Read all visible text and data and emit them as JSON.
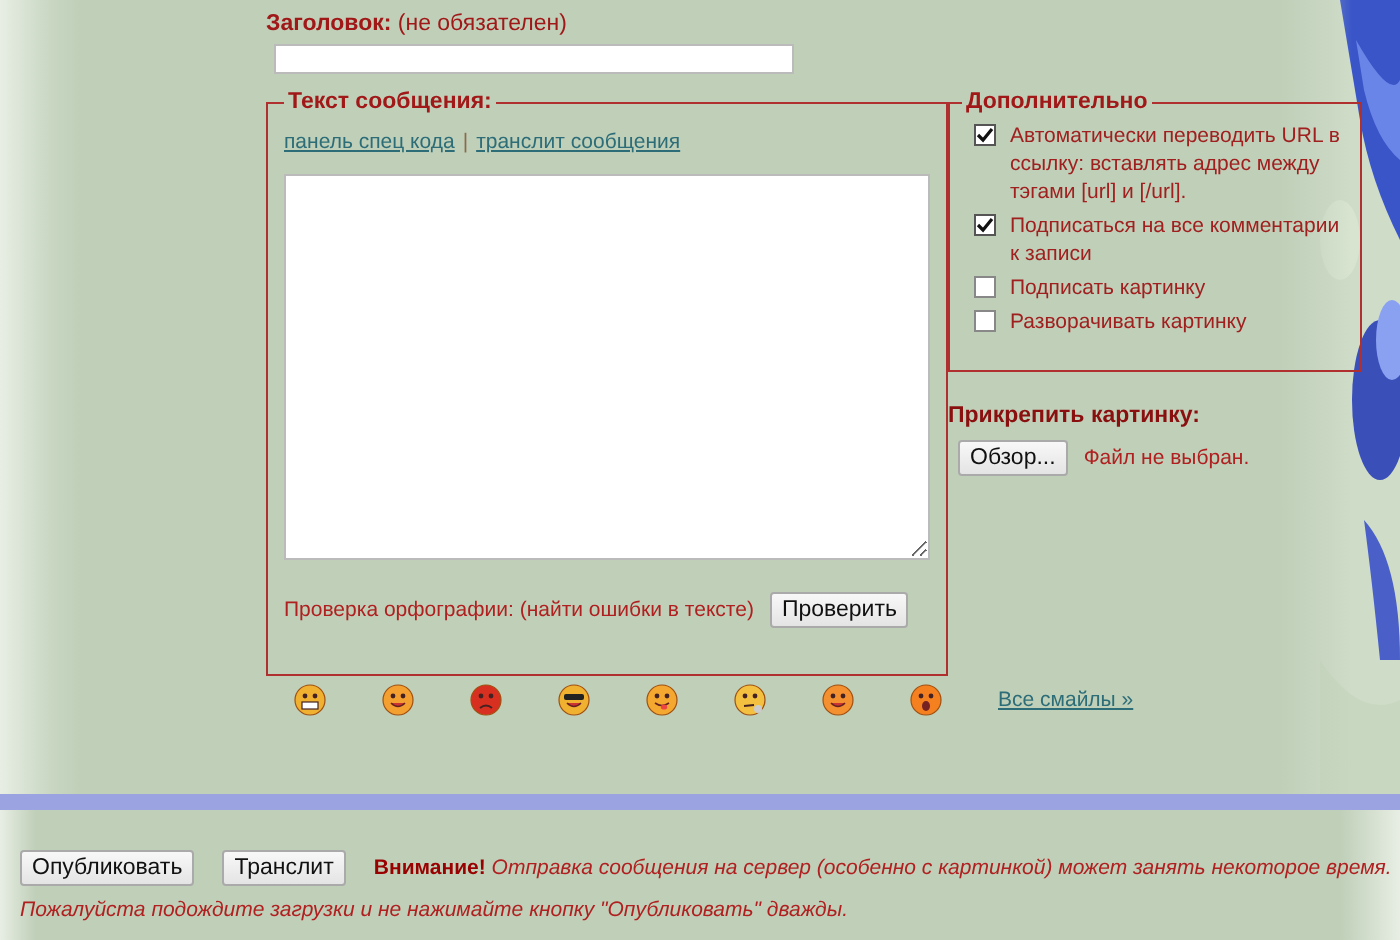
{
  "title_field": {
    "label": "**Заголовок:** (не обязателен)"
  },
  "message": {
    "legend": "Текст сообщения:",
    "links": [
      "панель спец кода",
      "транслит сообщения"
    ],
    "separator": "|",
    "spellcheck": {
      "label": "Проверка орфографии: (найти ошибки в тексте)",
      "button": "Проверить"
    }
  },
  "options": {
    "legend": "Дополнительно",
    "items": [
      {
        "label": "Автоматически переводить URL в ссылку: вставлять адрес между тэгами [url] и [/url].",
        "checked": true
      },
      {
        "label": "Подписаться на все комментарии к записи",
        "checked": true
      },
      {
        "label": "Подписать картинку",
        "checked": false
      },
      {
        "label": "Разворачивать картинку",
        "checked": false
      }
    ]
  },
  "attach": {
    "label": "Прикрепить картинку:",
    "button": "Обзор...",
    "status": "Файл не выбран."
  },
  "smileys": {
    "items": [
      {
        "kind": "grin"
      },
      {
        "kind": "smile"
      },
      {
        "kind": "angry"
      },
      {
        "kind": "cool"
      },
      {
        "kind": "tongue"
      },
      {
        "kind": "thinking"
      },
      {
        "kind": "blush"
      },
      {
        "kind": "surprised"
      }
    ],
    "link": "Все смайлы »"
  },
  "footer": {
    "buttons": [
      "Опубликовать",
      "Транслит"
    ],
    "warning": [
      "**Внимание!** Отправка сообщения на сервер (особенно с картинкой) может занять некоторое время.",
      "Пожалуйста подождите загрузки и не нажимайте кнопку \"Опубликовать\" дважды."
    ]
  }
}
